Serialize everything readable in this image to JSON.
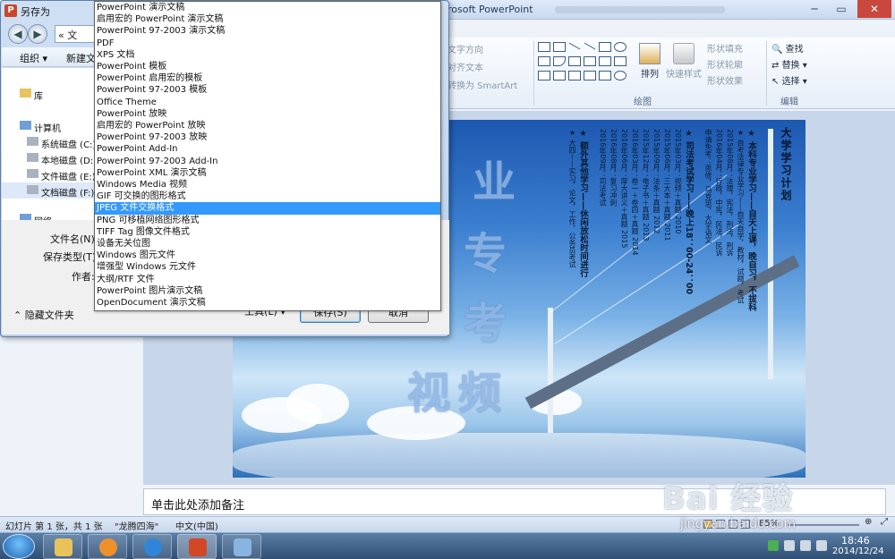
{
  "ppt": {
    "title": "rosoft PowerPoint",
    "min": "─",
    "max": "▭",
    "close": "✕",
    "ribbon": {
      "text_direction": "文字方向",
      "align_text": "对齐文本",
      "smartart": "转换为 SmartArt",
      "arrange": "排列",
      "quick_styles": "快速样式",
      "shape_fill": "形状填充",
      "shape_outline": "形状轮廓",
      "shape_effects": "形状效果",
      "find": "查找",
      "replace": "替换",
      "select": "选择",
      "group_drawing": "绘图",
      "group_editing": "编辑"
    },
    "slide": {
      "title": "大学学习计划",
      "big_chars": [
        "专",
        "业",
        "专",
        "考",
        "视",
        "频"
      ],
      "columns": [
        {
          "bold": true,
          "text": "★ 本科专业学习——自天上课，晚自习，不拔科"
        },
        {
          "bold": false,
          "text": "★ 自考法律专业学习——自天自学，教材，试题，考试"
        },
        {
          "bold": false,
          "text": "2015年08月：法理，宪法，刑法，刑诉"
        },
        {
          "bold": false,
          "text": "2016年04月：行政，中宪，民法，民诉"
        },
        {
          "bold": false,
          "text": "申请免考：思修，马克思，大学语文"
        },
        {
          "bold": true,
          "text": "★ 司法考试学习——晚上18：00-24：00"
        },
        {
          "bold": false,
          "text": "2015年03月：视频＋真题 2010"
        },
        {
          "bold": false,
          "text": "2015年06月：三大本＋真题 2011"
        },
        {
          "bold": false,
          "text": "2015年09月：法条＋真题 2012"
        },
        {
          "bold": false,
          "text": "2015年12月：电子书＋真题 2013"
        },
        {
          "bold": false,
          "text": "2016年03月：卷一＋卷四＋真题 2014"
        },
        {
          "bold": false,
          "text": "2016年06月：厚大讲义＋真题 2015"
        },
        {
          "bold": false,
          "text": "2016年08月：复习冲刺"
        },
        {
          "bold": false,
          "text": "2016年09月：司法考试"
        },
        {
          "bold": true,
          "text": "★ 额外其他学习——休闲放松时间进行"
        },
        {
          "bold": false,
          "text": "★ 大四——实习，论文，工作，公务员考试"
        }
      ]
    },
    "notes_placeholder": "单击此处添加备注",
    "status": {
      "slide_info": "幻灯片 第 1 张，共 1 张",
      "theme": "\"龙腾四海\"",
      "language": "中文(中国)",
      "zoom": "85%"
    }
  },
  "dialog": {
    "title": "另存为",
    "icon": "P",
    "back": "◀",
    "forward": "▶",
    "address": "«  文",
    "toolbar": {
      "organize": "组织 ▾",
      "new_folder": "新建文"
    },
    "nav": [
      {
        "label": "库",
        "indent": 0,
        "icon": "library-icon"
      },
      {
        "label": "计算机",
        "indent": 0,
        "icon": "computer-icon"
      },
      {
        "label": "系统磁盘 (C:)",
        "indent": 1,
        "icon": "drive-icon"
      },
      {
        "label": "本地磁盘 (D:)",
        "indent": 1,
        "icon": "drive-icon"
      },
      {
        "label": "文件磁盘 (E:)",
        "indent": 1,
        "icon": "drive-icon"
      },
      {
        "label": "文档磁盘 (F:)",
        "indent": 1,
        "icon": "drive-icon",
        "selected": true
      },
      {
        "label": "网络",
        "indent": 0,
        "icon": "network-icon"
      }
    ],
    "filename_label": "文件名(N):",
    "filetype_label": "保存类型(T):",
    "author_label": "作者:",
    "hide_folders": "隐藏文件夹",
    "tools": "工具(L)   ▾",
    "save": "保存(S)",
    "cancel": "取消",
    "file_types": [
      "PowerPoint 演示文稿",
      "启用宏的 PowerPoint 演示文稿",
      "PowerPoint 97-2003 演示文稿",
      "PDF",
      "XPS 文档",
      "PowerPoint 模板",
      "PowerPoint 启用宏的模板",
      "PowerPoint 97-2003 模板",
      "Office Theme",
      "PowerPoint 放映",
      "启用宏的 PowerPoint 放映",
      "PowerPoint 97-2003 放映",
      "PowerPoint Add-In",
      "PowerPoint 97-2003 Add-In",
      "PowerPoint XML 演示文稿",
      "Windows Media 视频",
      "GIF 可交换的图形格式",
      "JPEG 文件交换格式",
      "PNG 可移植网络图形格式",
      "TIFF Tag 图像文件格式",
      "设备无关位图",
      "Windows 图元文件",
      "增强型 Windows 元文件",
      "大纲/RTF 文件",
      "PowerPoint 图片演示文稿",
      "OpenDocument 演示文稿"
    ],
    "selected_type": "JPEG 文件交换格式"
  },
  "watermark": {
    "brand": "Bai 经验",
    "url": "jingyan.baidu.com"
  },
  "taskbar": {
    "time": "18:46",
    "date": "2014/12/24"
  }
}
